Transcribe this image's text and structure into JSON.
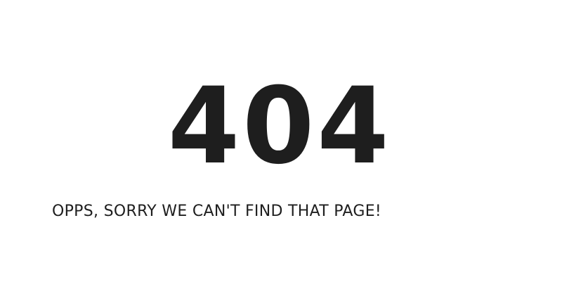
{
  "error": {
    "code": "404",
    "message": "OPPS, SORRY WE CAN'T FIND THAT PAGE!"
  }
}
